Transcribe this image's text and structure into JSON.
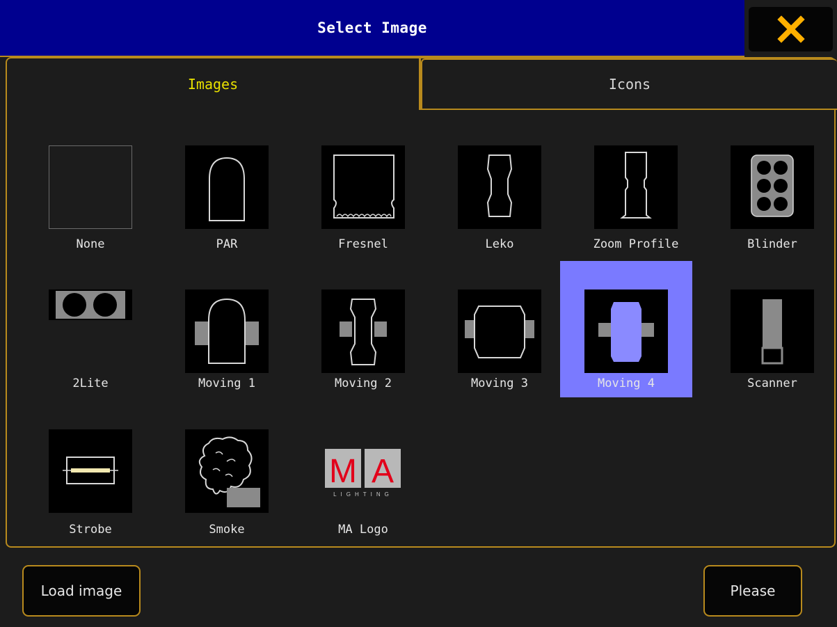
{
  "dialog": {
    "title": "Select Image",
    "close_icon": "close-x-icon"
  },
  "tabs": [
    {
      "label": "Images",
      "active": true
    },
    {
      "label": "Icons",
      "active": false
    }
  ],
  "items": [
    {
      "label": "None",
      "icon": "none-icon",
      "selected": false
    },
    {
      "label": "PAR",
      "icon": "par-fixture-icon",
      "selected": false
    },
    {
      "label": "Fresnel",
      "icon": "fresnel-fixture-icon",
      "selected": false
    },
    {
      "label": "Leko",
      "icon": "leko-fixture-icon",
      "selected": false
    },
    {
      "label": "Zoom Profile",
      "icon": "zoom-profile-fixture-icon",
      "selected": false
    },
    {
      "label": "Blinder",
      "icon": "blinder-fixture-icon",
      "selected": false
    },
    {
      "label": "2Lite",
      "icon": "2lite-fixture-icon",
      "selected": false
    },
    {
      "label": "Moving 1",
      "icon": "moving-1-fixture-icon",
      "selected": false
    },
    {
      "label": "Moving 2",
      "icon": "moving-2-fixture-icon",
      "selected": false
    },
    {
      "label": "Moving 3",
      "icon": "moving-3-fixture-icon",
      "selected": false
    },
    {
      "label": "Moving 4",
      "icon": "moving-4-fixture-icon",
      "selected": true
    },
    {
      "label": "Scanner",
      "icon": "scanner-fixture-icon",
      "selected": false
    },
    {
      "label": "Strobe",
      "icon": "strobe-fixture-icon",
      "selected": false
    },
    {
      "label": "Smoke",
      "icon": "smoke-fixture-icon",
      "selected": false
    },
    {
      "label": "MA Logo",
      "icon": "ma-logo-icon",
      "selected": false,
      "logo_letters": [
        "M",
        "A"
      ],
      "logo_subtext": "LIGHTING"
    }
  ],
  "footer": {
    "load_label": "Load image",
    "confirm_label": "Please"
  },
  "colors": {
    "title_bg": "#00008f",
    "accent_border": "#b88a1d",
    "active_tab_text": "#e8e000",
    "selected_bg": "#7a7aff",
    "close_icon": "#ffb000",
    "outline": "#d8d8d8",
    "fill_gray": "#8a8a8a",
    "logo_red": "#e2001a"
  }
}
